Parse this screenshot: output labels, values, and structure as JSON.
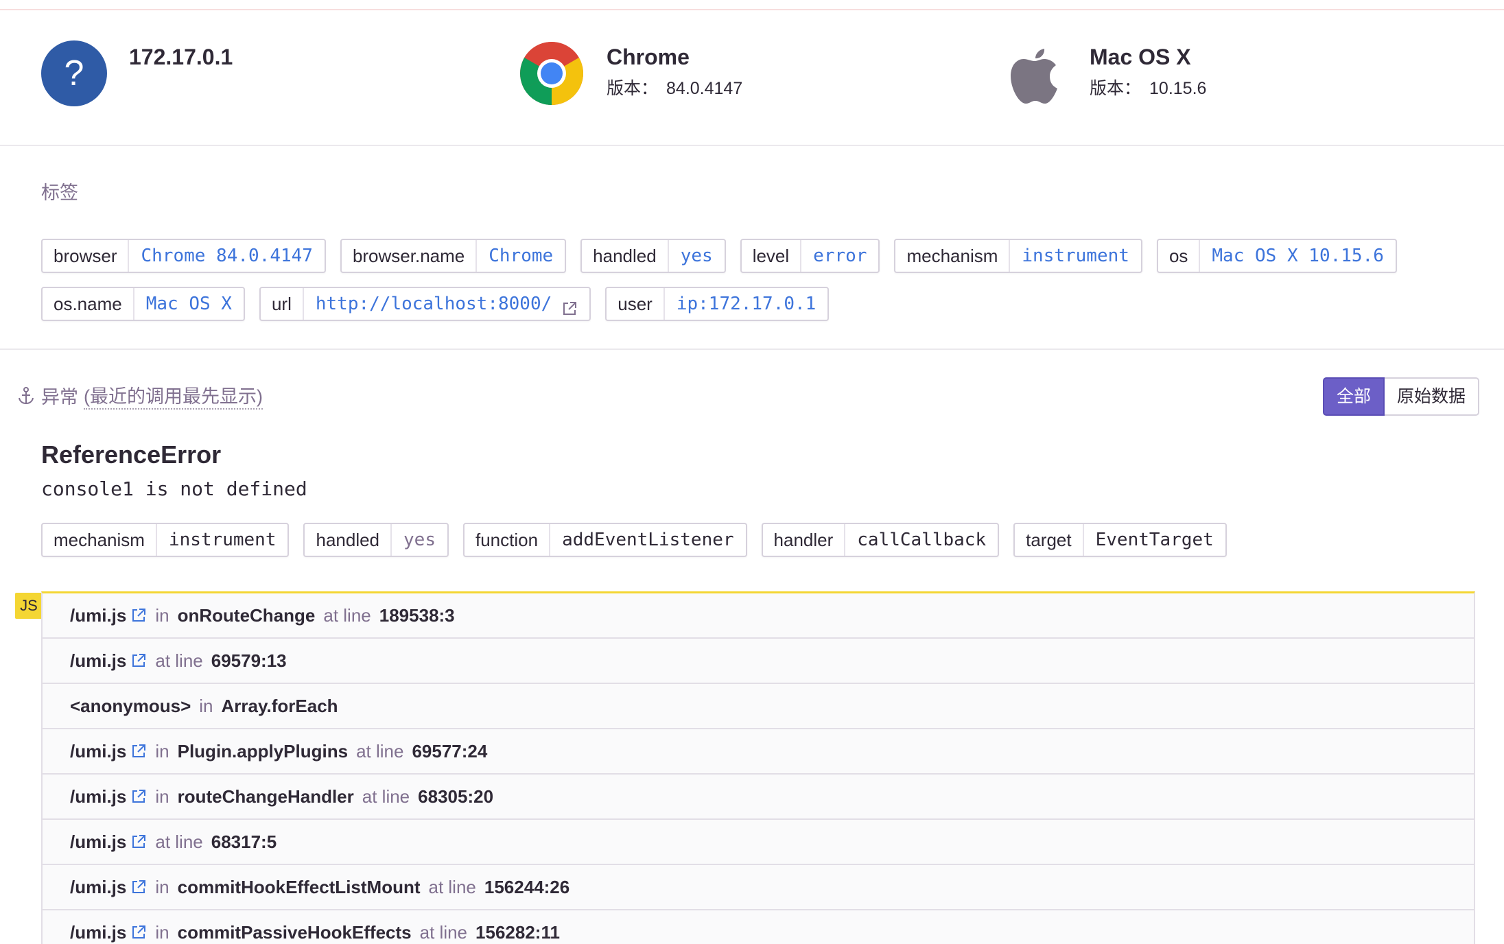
{
  "context": {
    "ip": {
      "title": "172.17.0.1",
      "icon": "unknown-user-icon"
    },
    "browser": {
      "title": "Chrome",
      "version_label": "版本：",
      "version": "84.0.4147",
      "icon": "chrome-icon"
    },
    "os": {
      "title": "Mac OS X",
      "version_label": "版本：",
      "version": "10.15.6",
      "icon": "apple-icon"
    }
  },
  "tags_section": {
    "title": "标签",
    "tags": [
      {
        "key": "browser",
        "value": "Chrome 84.0.4147"
      },
      {
        "key": "browser.name",
        "value": "Chrome"
      },
      {
        "key": "handled",
        "value": "yes"
      },
      {
        "key": "level",
        "value": "error"
      },
      {
        "key": "mechanism",
        "value": "instrument"
      },
      {
        "key": "os",
        "value": "Mac OS X 10.15.6"
      },
      {
        "key": "os.name",
        "value": "Mac OS X"
      },
      {
        "key": "url",
        "value": "http://localhost:8000/"
      },
      {
        "key": "user",
        "value": "ip:172.17.0.1"
      }
    ]
  },
  "exception": {
    "header": "异常",
    "header_sub": "(最近的调用最先显示)",
    "buttons": {
      "all": "全部",
      "raw": "原始数据"
    },
    "type": "ReferenceError",
    "message": "console1 is not defined",
    "mechanism_tags": [
      {
        "key": "mechanism",
        "value": "instrument"
      },
      {
        "key": "handled",
        "value": "yes"
      },
      {
        "key": "function",
        "value": "addEventListener"
      },
      {
        "key": "handler",
        "value": "callCallback"
      },
      {
        "key": "target",
        "value": "EventTarget"
      }
    ],
    "platform_badge": "JS",
    "frames": [
      {
        "file": "/umi.js",
        "in": "in",
        "function": "onRouteChange",
        "at_line": "at line",
        "line": "189538:3"
      },
      {
        "file": "/umi.js",
        "in": "",
        "function": "",
        "at_line": "at line",
        "line": "69579:13"
      },
      {
        "file": "<anonymous>",
        "in": "in",
        "function": "Array.forEach",
        "at_line": "",
        "line": ""
      },
      {
        "file": "/umi.js",
        "in": "in",
        "function": "Plugin.applyPlugins",
        "at_line": "at line",
        "line": "69577:24"
      },
      {
        "file": "/umi.js",
        "in": "in",
        "function": "routeChangeHandler",
        "at_line": "at line",
        "line": "68305:20"
      },
      {
        "file": "/umi.js",
        "in": "",
        "function": "",
        "at_line": "at line",
        "line": "68317:5"
      },
      {
        "file": "/umi.js",
        "in": "in",
        "function": "commitHookEffectListMount",
        "at_line": "at line",
        "line": "156244:26"
      },
      {
        "file": "/umi.js",
        "in": "in",
        "function": "commitPassiveHookEffects",
        "at_line": "at line",
        "line": "156282:11"
      }
    ]
  }
}
